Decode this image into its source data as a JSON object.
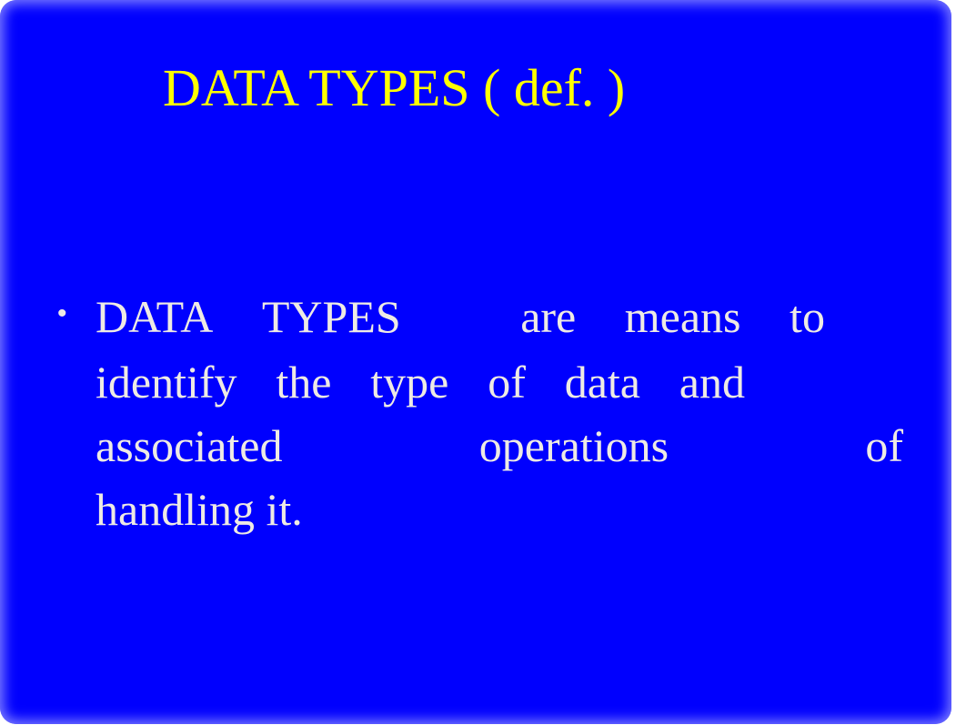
{
  "slide": {
    "title": "DATA TYPES ( def. )",
    "bullet_glyph": "•",
    "bullet_lines": [
      [
        "DATA",
        "TYPES",
        "are",
        "means",
        "to"
      ],
      [
        "identify",
        "the",
        "type",
        "of",
        "data",
        "and"
      ],
      [
        "associated",
        "operations",
        "of"
      ],
      [
        "handling it."
      ]
    ],
    "bullet_text": "DATA TYPES are means to identify the type of data and associated operations of handling it."
  },
  "colors": {
    "background": "#0000fe",
    "title": "#ffff00",
    "body_text": "#eeeae4"
  }
}
